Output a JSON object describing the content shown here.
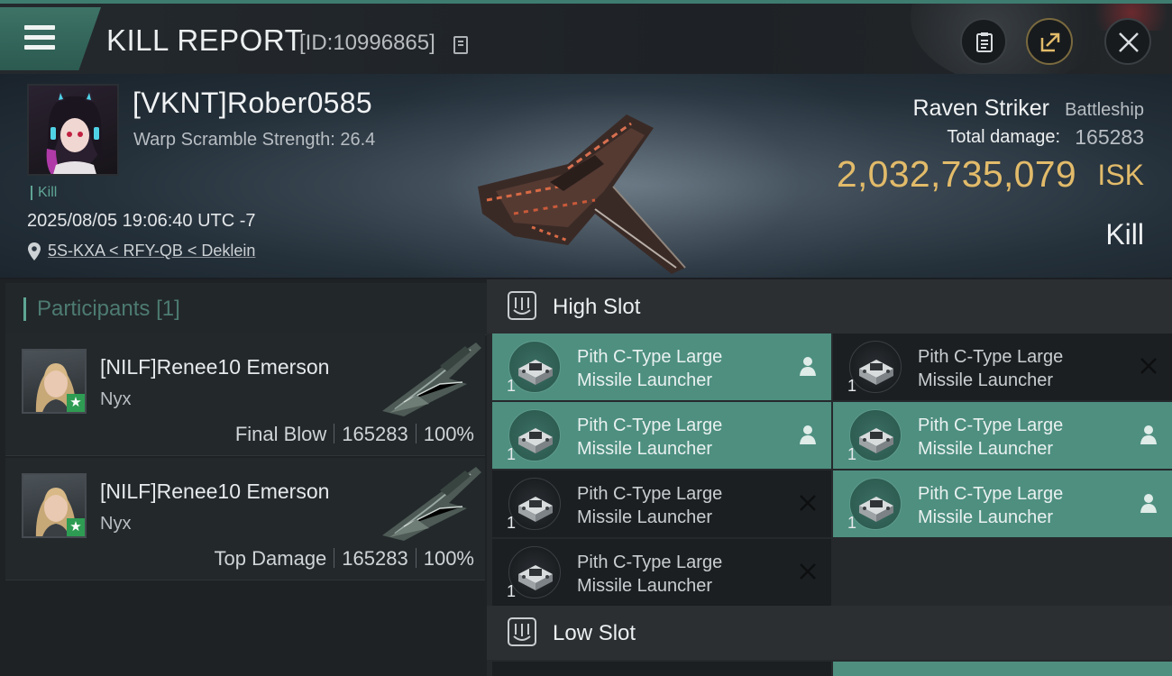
{
  "header": {
    "title": "KILL REPORT",
    "report_id": "[ID:10996865]"
  },
  "victim": {
    "name": "[VKNT]Rober0585",
    "warp_scramble": "Warp Scramble Strength: 26.4",
    "tag": "Kill",
    "datetime": "2025/08/05 19:06:40 UTC -7",
    "location": "5S-KXA < RFY-QB < Deklein"
  },
  "ship": {
    "name": "Raven Striker",
    "class": "Battleship",
    "damage_label": "Total damage:",
    "damage_value": "165283",
    "isk_value": "2,032,735,079",
    "isk_unit": "ISK",
    "outcome": "Kill"
  },
  "participants": {
    "title": "Participants",
    "count": "[1]",
    "rows": [
      {
        "name": "[NILF]Renee10 Emerson",
        "ship": "Nyx",
        "role": "Final Blow",
        "damage": "165283",
        "percent": "100%"
      },
      {
        "name": "[NILF]Renee10 Emerson",
        "ship": "Nyx",
        "role": "Top Damage",
        "damage": "165283",
        "percent": "100%"
      }
    ]
  },
  "slots": {
    "high": {
      "title": "High Slot",
      "items": [
        {
          "line1": "Pith C-Type Large",
          "line2": "Missile Launcher",
          "qty": "1",
          "status": "fitted"
        },
        {
          "line1": "Pith C-Type Large",
          "line2": "Missile Launcher",
          "qty": "1",
          "status": "destroyed"
        },
        {
          "line1": "Pith C-Type Large",
          "line2": "Missile Launcher",
          "qty": "1",
          "status": "fitted"
        },
        {
          "line1": "Pith C-Type Large",
          "line2": "Missile Launcher",
          "qty": "1",
          "status": "fitted"
        },
        {
          "line1": "Pith C-Type Large",
          "line2": "Missile Launcher",
          "qty": "1",
          "status": "destroyed"
        },
        {
          "line1": "Pith C-Type Large",
          "line2": "Missile Launcher",
          "qty": "1",
          "status": "fitted"
        },
        {
          "line1": "Pith C-Type Large",
          "line2": "Missile Launcher",
          "qty": "1",
          "status": "destroyed"
        }
      ]
    },
    "low": {
      "title": "Low Slot"
    }
  },
  "colors": {
    "accent": "#4e8f80",
    "isk": "#e2bb6a",
    "tag": "#5fa594"
  },
  "icons": [
    "menu-icon",
    "copy-icon",
    "clipboard-icon",
    "share-icon",
    "close-icon",
    "location-pin-icon",
    "slot-icon",
    "person-icon",
    "x-icon"
  ]
}
